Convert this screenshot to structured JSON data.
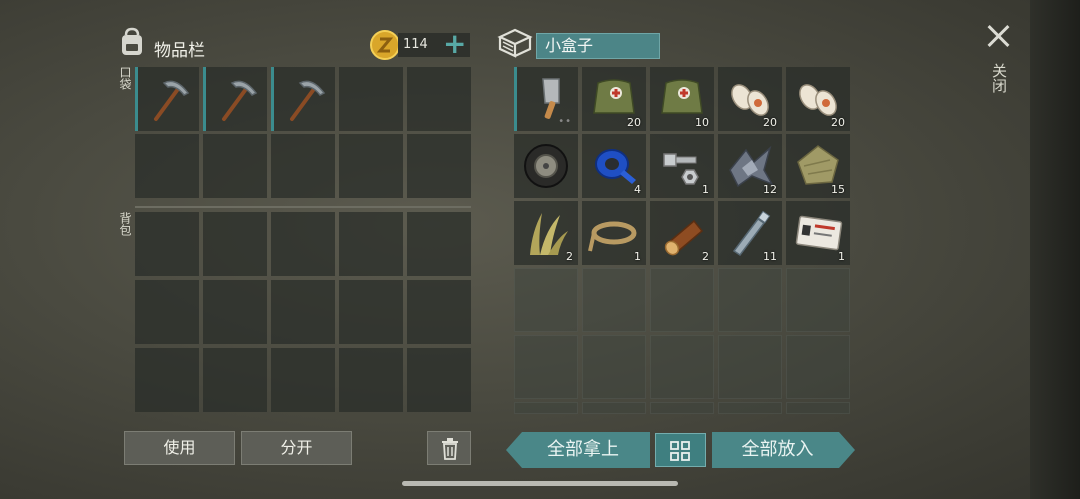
{
  "inventory": {
    "title": "物品栏",
    "coins": "114",
    "add_symbol": "+",
    "pocket_label": "口袋",
    "backpack_label": "背包",
    "pocket_items": [
      {
        "icon": "pickaxe-icon",
        "qty": ""
      },
      {
        "icon": "pickaxe-icon",
        "qty": ""
      },
      {
        "icon": "pickaxe-icon",
        "qty": ""
      }
    ]
  },
  "container": {
    "name": "小盒子",
    "items": [
      {
        "icon": "cleaver-icon",
        "qty": "••"
      },
      {
        "icon": "medkit-bag-icon",
        "qty": "20"
      },
      {
        "icon": "medkit-bag-icon",
        "qty": "10"
      },
      {
        "icon": "bandage-icon",
        "qty": "20"
      },
      {
        "icon": "bandage-icon",
        "qty": "20"
      },
      {
        "icon": "tire-icon",
        "qty": ""
      },
      {
        "icon": "duct-tape-icon",
        "qty": "4"
      },
      {
        "icon": "bolt-nut-icon",
        "qty": "1"
      },
      {
        "icon": "scrap-metal-icon",
        "qty": "12"
      },
      {
        "icon": "cloth-icon",
        "qty": "15"
      },
      {
        "icon": "plant-fiber-icon",
        "qty": "2"
      },
      {
        "icon": "rope-icon",
        "qty": "1"
      },
      {
        "icon": "log-icon",
        "qty": "2"
      },
      {
        "icon": "plastic-bottle-icon",
        "qty": "11"
      },
      {
        "icon": "army-card-icon",
        "qty": "1"
      }
    ]
  },
  "buttons": {
    "use": "使用",
    "split": "分开",
    "take_all": "全部拿上",
    "put_all": "全部放入"
  },
  "close_label": "关闭"
}
